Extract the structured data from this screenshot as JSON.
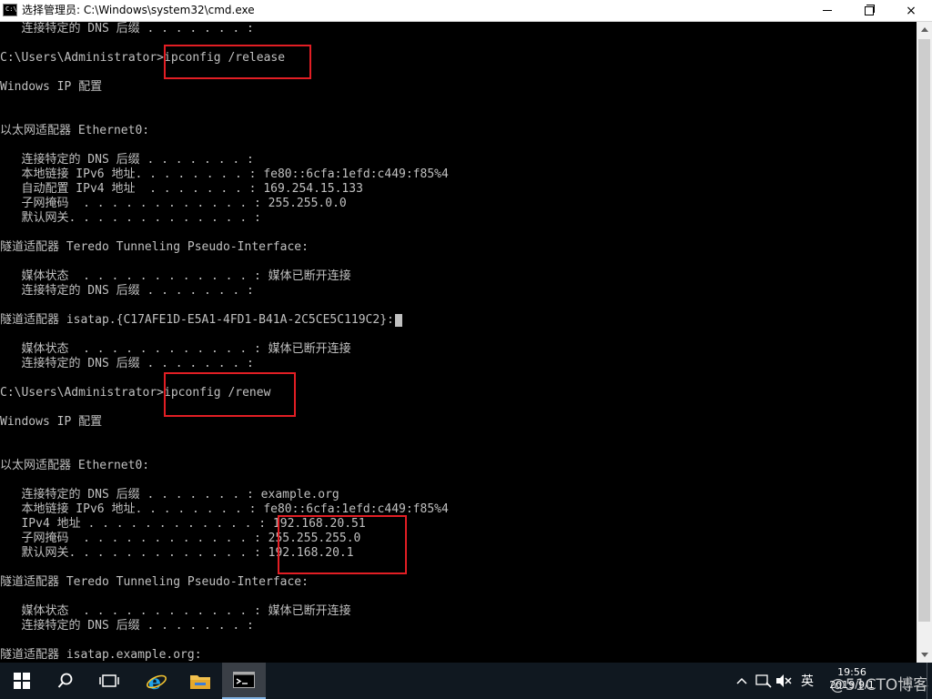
{
  "window": {
    "title": "选择管理员: C:\\Windows\\system32\\cmd.exe",
    "icon_label": "C:\\",
    "controls": {
      "minimize": "minimize-icon",
      "maximize": "maximize-icon",
      "close": "×"
    }
  },
  "console_lines": [
    "   连接特定的 DNS 后缀 . . . . . . . :",
    "",
    "C:\\Users\\Administrator>ipconfig /release",
    "",
    "Windows IP 配置",
    "",
    "",
    "以太网适配器 Ethernet0:",
    "",
    "   连接特定的 DNS 后缀 . . . . . . . :",
    "   本地链接 IPv6 地址. . . . . . . . : fe80::6cfa:1efd:c449:f85%4",
    "   自动配置 IPv4 地址  . . . . . . . : 169.254.15.133",
    "   子网掩码  . . . . . . . . . . . . : 255.255.0.0",
    "   默认网关. . . . . . . . . . . . . :",
    "",
    "隧道适配器 Teredo Tunneling Pseudo-Interface:",
    "",
    "   媒体状态  . . . . . . . . . . . . : 媒体已断开连接",
    "   连接特定的 DNS 后缀 . . . . . . . :",
    "",
    "隧道适配器 isatap.{C17AFE1D-E5A1-4FD1-B41A-2C5CE5C119C2}:",
    "",
    "   媒体状态  . . . . . . . . . . . . : 媒体已断开连接",
    "   连接特定的 DNS 后缀 . . . . . . . :",
    "",
    "C:\\Users\\Administrator>ipconfig /renew",
    "",
    "Windows IP 配置",
    "",
    "",
    "以太网适配器 Ethernet0:",
    "",
    "   连接特定的 DNS 后缀 . . . . . . . : example.org",
    "   本地链接 IPv6 地址. . . . . . . . : fe80::6cfa:1efd:c449:f85%4",
    "   IPv4 地址 . . . . . . . . . . . . : 192.168.20.51",
    "   子网掩码  . . . . . . . . . . . . : 255.255.255.0",
    "   默认网关. . . . . . . . . . . . . : 192.168.20.1",
    "",
    "隧道适配器 Teredo Tunneling Pseudo-Interface:",
    "",
    "   媒体状态  . . . . . . . . . . . . : 媒体已断开连接",
    "   连接特定的 DNS 后缀 . . . . . . . :",
    "",
    "隧道适配器 isatap.example.org:"
  ],
  "taskbar": {
    "start": "windows-start-icon",
    "search": "search-icon",
    "task_view": "task-view-icon",
    "ie": "internet-explorer-icon",
    "explorer": "file-explorer-icon",
    "cmd": "command-prompt-icon"
  },
  "tray": {
    "ime": "英",
    "time": "19:56",
    "date": "2019/9/1",
    "watermark": "@51CTO博客"
  },
  "colors": {
    "console_bg": "#000000",
    "console_fg": "#c0c0c0",
    "highlight": "#e21e24",
    "taskbar": "#101820"
  }
}
